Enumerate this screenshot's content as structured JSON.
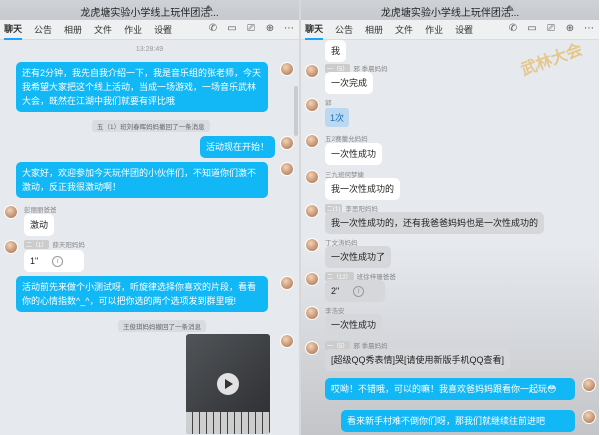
{
  "left": {
    "title": "龙虎塘实验小学线上玩伴团活...",
    "tabs": [
      "聊天",
      "公告",
      "相册",
      "文件",
      "作业",
      "设置"
    ],
    "time": "13:28:49",
    "notice1": "五（1）班刘春晖妈妈撤回了一条消息",
    "notice2": "王俊琪妈妈撤回了一条消息",
    "msg_intro": "还有2分钟，我先自我介绍一下，我是音乐组的张老师，今天我希望大家把这个线上活动，当成一场游戏，一场音乐武林大会，既然在江湖中我们就要有评比哦",
    "msg_start": "活动现在开始！",
    "msg_welcome": "大家好，欢迎参加今天玩伴团的小伙伴们，不知道你们激不激动，反正我很激动啊！",
    "sender1": "彭丽丽爸爸",
    "msg_excited": "激动",
    "sender2_lvl": "二（1）",
    "sender2": "薛天阳妈妈",
    "voice1": "1\"",
    "msg_test": "活动前先来做个小测试呀，听旋律选择你喜欢的片段，看看你的心情指数^_^，可以把你选的两个选项发到群里哦!"
  },
  "right": {
    "title": "龙虎塘实验小学线上玩伴团活...",
    "tabs": [
      "聊天",
      "公告",
      "相册",
      "文件",
      "作业",
      "设置"
    ],
    "top_msg": "我",
    "s1_lvl": "一（5）",
    "s1": "邪 季晨妈妈",
    "m1": "一次完成",
    "s2": "郭",
    "m2": "1次",
    "s3": "五2赛蕾允妈妈",
    "m3": "一次性成功",
    "s4": "三九班何梦婕",
    "m4": "我一次性成功的",
    "s5_lvl": "二(1)",
    "s5": "李思阳妈妈",
    "m5": "我一次性成功的，还有我爸爸妈妈也是一次性成功的",
    "s6": "丁文涛妈妈",
    "m6": "一次性成功了",
    "s7_lvl": "二（12）",
    "s7": "班徐梓珊爸爸",
    "voice2": "2\"",
    "s8": "李浩安",
    "m8": "一次性成功",
    "s9_lvl": "一（5）",
    "s9": "邪 季晨妈妈",
    "m9": "[超级QQ秀表情]哭[请使用新版手机QQ查看]",
    "m10": "哎呦！不错哦，可以的嘛！我喜欢爸妈妈跟看你一起玩😳",
    "m11": "看来新手村难不倒你们呀，那我们就继续往前进吧",
    "art_text": "武林大会"
  },
  "colors": {
    "blue_bubble": "#12b7f5",
    "bg": "#e6e9ee"
  }
}
